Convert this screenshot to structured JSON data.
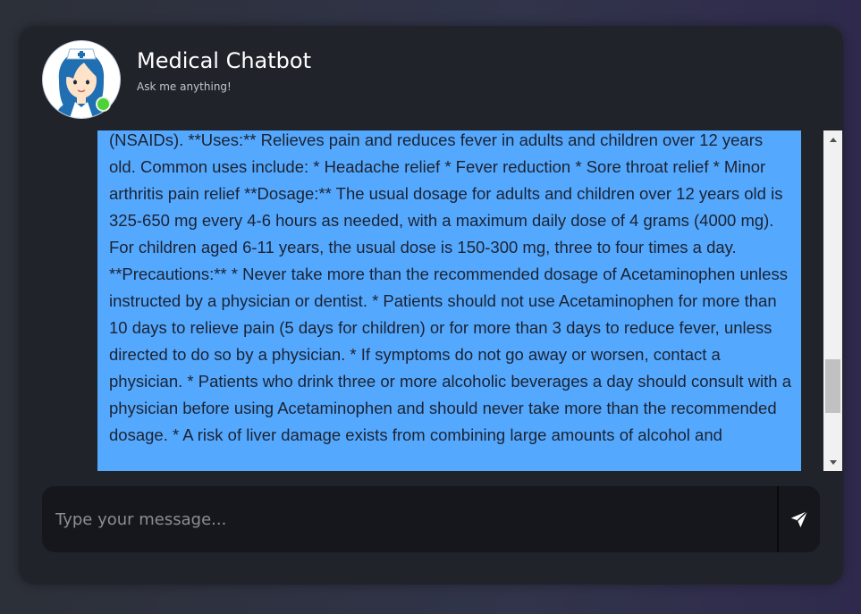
{
  "header": {
    "title": "Medical Chatbot",
    "subtitle": "Ask me anything!",
    "status": "online",
    "avatar_icon": "nurse-avatar-icon"
  },
  "messages": [
    {
      "sender": "bot",
      "text": "(NSAIDs). **Uses:** Relieves pain and reduces fever in adults and children over 12 years old. Common uses include: * Headache relief * Fever reduction * Sore throat relief * Minor arthritis pain relief **Dosage:** The usual dosage for adults and children over 12 years old is 325-650 mg every 4-6 hours as needed, with a maximum daily dose of 4 grams (4000 mg). For children aged 6-11 years, the usual dose is 150-300 mg, three to four times a day. **Precautions:** * Never take more than the recommended dosage of Acetaminophen unless instructed by a physician or dentist. * Patients should not use Acetaminophen for more than 10 days to relieve pain (5 days for children) or for more than 3 days to reduce fever, unless directed to do so by a physician. * If symptoms do not go away or worsen, contact a physician. * Patients who drink three or more alcoholic beverages a day should consult with a physician before using Acetaminophen and should never take more than the recommended dosage. * A risk of liver damage exists from combining large amounts of alcohol and",
      "bubble_color": "#54a9ff"
    }
  ],
  "input": {
    "placeholder": "Type your message...",
    "value": "",
    "send_icon": "send-icon"
  },
  "colors": {
    "card_bg": "#20232a",
    "bubble": "#54a9ff",
    "status_online": "#4cd137",
    "input_bg": "#15171c"
  },
  "scroll": {
    "position_fraction": 0.75
  }
}
